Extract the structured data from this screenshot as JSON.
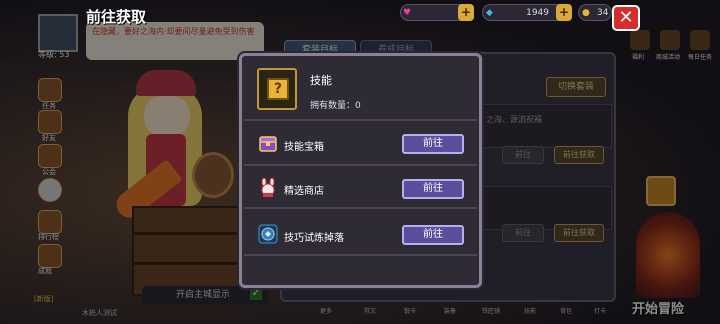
{
  "header": {
    "title": "前往获取",
    "resources": [
      {
        "name": "heart-resource",
        "value": "",
        "color": "#e0448a"
      },
      {
        "name": "diamond-resource",
        "value": "1949",
        "color": "#49b8e8"
      },
      {
        "name": "gold-resource",
        "value": "34",
        "color": "#e8b43a"
      }
    ],
    "close_label": "✕"
  },
  "player": {
    "level": "等级: 53"
  },
  "left_menu": [
    "任务",
    "好友",
    "公会",
    "排行榜",
    "成就"
  ],
  "left_bottom": {
    "event_text": "[新版]",
    "bubble_text": "在隐藏，要好之海内·却要间尽量避免受到伤害"
  },
  "toggle": {
    "label": "开启主城显示",
    "checked": true
  },
  "background_panel": {
    "tabs": [
      "套装目标",
      "养成目标"
    ],
    "switch_button": "切换套装",
    "row_text": "之海、源流祝福",
    "row_buttons": [
      [
        "前往",
        "前往获取"
      ],
      [
        "前往",
        "前往获取"
      ]
    ]
  },
  "right_icons": [
    "福利",
    "商城活动",
    "每日任务"
  ],
  "start_button": "开始冒险",
  "bottom_bar": [
    "更多",
    "符文",
    "锻卡",
    "装备",
    "铁匠铺",
    "技能",
    "背包",
    "打卡"
  ],
  "bottom_left_label": "木桩人测试",
  "popup": {
    "item": {
      "name": "技能",
      "count": "拥有数量：0",
      "icon": "question-mark-box-icon"
    },
    "sources": [
      {
        "label": "技能宝箱",
        "button": "前往",
        "icon": "treasure-chest-icon"
      },
      {
        "label": "精选商店",
        "button": "前往",
        "icon": "rabbit-shop-icon"
      },
      {
        "label": "技巧试炼掉落",
        "button": "前往",
        "icon": "trial-orb-icon"
      }
    ]
  }
}
